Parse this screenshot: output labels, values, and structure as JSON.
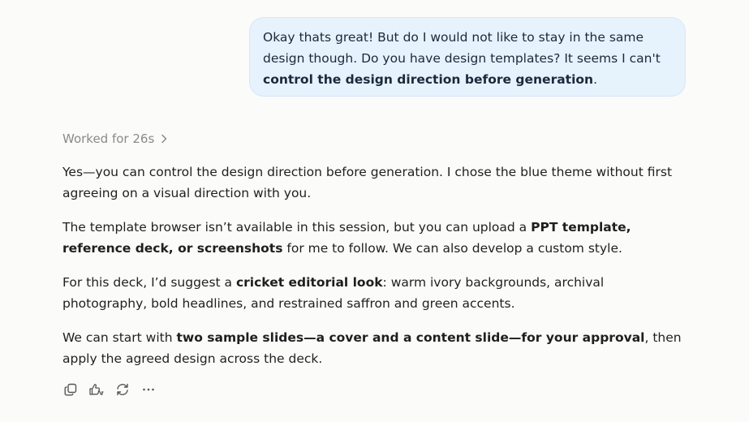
{
  "user_message": {
    "part1": "Okay thats great! But do I would not like to stay in the same design though. Do you have design templates? It seems I can't ",
    "bold": "control the design direction before generation",
    "part2": "."
  },
  "worked": {
    "label": "Worked for 26s",
    "icon": "chevron-right-icon"
  },
  "response": {
    "p1": "Yes—you can control the design direction before generation. I chose the blue theme without first agreeing on a visual direction with you.",
    "p2": {
      "a": "The template browser isn’t available in this session, but you can upload a ",
      "bold": "PPT template, reference deck, or screenshots",
      "b": " for me to follow. We can also develop a custom style."
    },
    "p3": {
      "a": "For this deck, I’d suggest a ",
      "bold": "cricket editorial look",
      "b": ": warm ivory backgrounds, archival photography, bold headlines, and restrained saffron and green accents."
    },
    "p4": {
      "a": "We can start with ",
      "bold": "two sample slides—a cover and a content slide—for your approval",
      "b": ", then apply the agreed design across the deck."
    }
  },
  "actions": [
    {
      "name": "copy",
      "icon": "copy-icon"
    },
    {
      "name": "feedback",
      "icon": "thumbs-up-down-icon"
    },
    {
      "name": "regenerate",
      "icon": "refresh-icon"
    },
    {
      "name": "more",
      "icon": "more-horizontal-icon"
    }
  ],
  "colors": {
    "background": "#fbfbfa",
    "user_bubble": "#e6f2fc",
    "muted_text": "#8a8a8a",
    "text": "#1f1f1f"
  }
}
